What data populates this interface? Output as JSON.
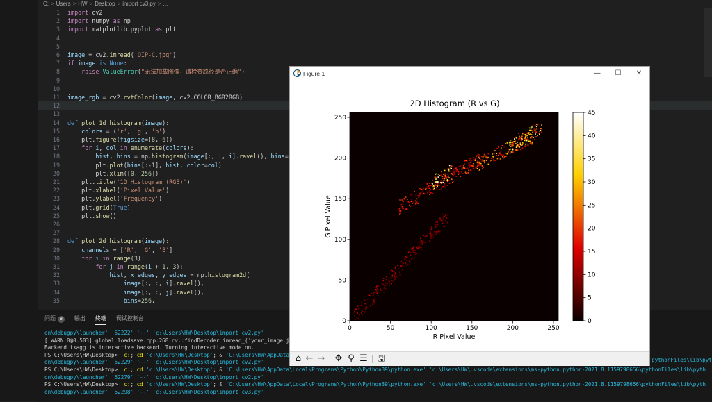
{
  "breadcrumb": [
    "C:",
    "Users",
    "HW",
    "Desktop",
    "import cv3.py",
    "..."
  ],
  "code_lines": [
    {
      "n": "1",
      "segs": [
        [
          "kw",
          "import "
        ],
        [
          "",
          "cv2"
        ]
      ]
    },
    {
      "n": "2",
      "segs": [
        [
          "kw",
          "import "
        ],
        [
          "",
          "numpy "
        ],
        [
          "kw",
          "as "
        ],
        [
          "",
          "np"
        ]
      ]
    },
    {
      "n": "3",
      "segs": [
        [
          "kw",
          "import "
        ],
        [
          "",
          "matplotlib.pyplot "
        ],
        [
          "kw",
          "as "
        ],
        [
          "",
          "plt"
        ]
      ]
    },
    {
      "n": "4",
      "segs": []
    },
    {
      "n": "5",
      "segs": []
    },
    {
      "n": "6",
      "segs": [
        [
          "vr",
          "image"
        ],
        [
          "",
          " = cv2."
        ],
        [
          "fn",
          "imread"
        ],
        [
          "",
          "("
        ],
        [
          "st",
          "'OIP-C.jpg'"
        ],
        [
          "",
          ")"
        ]
      ]
    },
    {
      "n": "7",
      "segs": [
        [
          "kw",
          "if "
        ],
        [
          "vr",
          "image "
        ],
        [
          "kb",
          "is None"
        ],
        [
          "",
          ":"
        ]
      ]
    },
    {
      "n": "8",
      "segs": [
        [
          "",
          "    "
        ],
        [
          "kw",
          "raise "
        ],
        [
          "cl",
          "ValueError"
        ],
        [
          "",
          "("
        ],
        [
          "st",
          "\"无法加载图像，请检查路径是否正确\""
        ],
        [
          "",
          ")"
        ]
      ]
    },
    {
      "n": "9",
      "segs": []
    },
    {
      "n": "10",
      "segs": []
    },
    {
      "n": "11",
      "segs": [
        [
          "vr",
          "image_rgb"
        ],
        [
          "",
          " = cv2."
        ],
        [
          "fn",
          "cvtColor"
        ],
        [
          "",
          "("
        ],
        [
          "vr",
          "image"
        ],
        [
          "",
          ", cv2.COLOR_BGR2RGB)"
        ]
      ]
    },
    {
      "n": "12",
      "segs": []
    },
    {
      "n": "13",
      "segs": []
    },
    {
      "n": "14",
      "segs": [
        [
          "kb",
          "def "
        ],
        [
          "fn",
          "plot_1d_histogram"
        ],
        [
          "",
          "("
        ],
        [
          "vr",
          "image"
        ],
        [
          "",
          "):"
        ]
      ]
    },
    {
      "n": "15",
      "segs": [
        [
          "",
          "    "
        ],
        [
          "vr",
          "colors"
        ],
        [
          "",
          " = ("
        ],
        [
          "st",
          "'r'"
        ],
        [
          "",
          ", "
        ],
        [
          "st",
          "'g'"
        ],
        [
          "",
          ", "
        ],
        [
          "st",
          "'b'"
        ],
        [
          "",
          ")"
        ]
      ]
    },
    {
      "n": "16",
      "segs": [
        [
          "",
          "    plt."
        ],
        [
          "fn",
          "figure"
        ],
        [
          "",
          "("
        ],
        [
          "vr",
          "figsize"
        ],
        [
          "",
          "=("
        ],
        [
          "nm",
          "8"
        ],
        [
          "",
          ", "
        ],
        [
          "nm",
          "6"
        ],
        [
          "",
          "))"
        ]
      ]
    },
    {
      "n": "17",
      "segs": [
        [
          "",
          "    "
        ],
        [
          "kw",
          "for "
        ],
        [
          "vr",
          "i"
        ],
        [
          "",
          ", "
        ],
        [
          "vr",
          "col "
        ],
        [
          "kw",
          "in "
        ],
        [
          "fn",
          "enumerate"
        ],
        [
          "",
          "("
        ],
        [
          "vr",
          "colors"
        ],
        [
          "",
          "):"
        ]
      ]
    },
    {
      "n": "18",
      "segs": [
        [
          "",
          "        "
        ],
        [
          "vr",
          "hist"
        ],
        [
          "",
          ", "
        ],
        [
          "vr",
          "bins"
        ],
        [
          "",
          " = np."
        ],
        [
          "fn",
          "histogram"
        ],
        [
          "",
          "("
        ],
        [
          "vr",
          "image"
        ],
        [
          "",
          "[:, :, "
        ],
        [
          "vr",
          "i"
        ],
        [
          "",
          "]."
        ],
        [
          "fn",
          "ravel"
        ],
        [
          "",
          "(), "
        ],
        [
          "vr",
          "bins"
        ],
        [
          "",
          "=2"
        ]
      ]
    },
    {
      "n": "19",
      "segs": [
        [
          "",
          "        plt."
        ],
        [
          "fn",
          "plot"
        ],
        [
          "",
          "("
        ],
        [
          "vr",
          "bins"
        ],
        [
          "",
          "[:-1], "
        ],
        [
          "vr",
          "hist"
        ],
        [
          "",
          ", "
        ],
        [
          "vr",
          "color"
        ],
        [
          "",
          "="
        ],
        [
          "vr",
          "col"
        ],
        [
          "",
          ")"
        ]
      ]
    },
    {
      "n": "20",
      "segs": [
        [
          "",
          "        plt."
        ],
        [
          "fn",
          "xlim"
        ],
        [
          "",
          "(["
        ],
        [
          "nm",
          "0"
        ],
        [
          "",
          ", "
        ],
        [
          "nm",
          "256"
        ],
        [
          "",
          "])"
        ]
      ]
    },
    {
      "n": "21",
      "segs": [
        [
          "",
          "    plt."
        ],
        [
          "fn",
          "title"
        ],
        [
          "",
          "("
        ],
        [
          "st",
          "'1D Histogram (RGB)'"
        ],
        [
          "",
          ")"
        ]
      ]
    },
    {
      "n": "22",
      "segs": [
        [
          "",
          "    plt."
        ],
        [
          "fn",
          "xlabel"
        ],
        [
          "",
          "("
        ],
        [
          "st",
          "'Pixel Value'"
        ],
        [
          "",
          ")"
        ]
      ]
    },
    {
      "n": "23",
      "segs": [
        [
          "",
          "    plt."
        ],
        [
          "fn",
          "ylabel"
        ],
        [
          "",
          "("
        ],
        [
          "st",
          "'Frequency'"
        ],
        [
          "",
          ")"
        ]
      ]
    },
    {
      "n": "24",
      "segs": [
        [
          "",
          "    plt."
        ],
        [
          "fn",
          "grid"
        ],
        [
          "",
          "("
        ],
        [
          "kb",
          "True"
        ],
        [
          "",
          ")"
        ]
      ]
    },
    {
      "n": "25",
      "segs": [
        [
          "",
          "    plt."
        ],
        [
          "fn",
          "show"
        ],
        [
          "",
          "()"
        ]
      ]
    },
    {
      "n": "26",
      "segs": []
    },
    {
      "n": "27",
      "segs": []
    },
    {
      "n": "28",
      "segs": [
        [
          "kb",
          "def "
        ],
        [
          "fn",
          "plot_2d_histogram"
        ],
        [
          "",
          "("
        ],
        [
          "vr",
          "image"
        ],
        [
          "",
          "):"
        ]
      ]
    },
    {
      "n": "29",
      "segs": [
        [
          "",
          "    "
        ],
        [
          "vr",
          "channels"
        ],
        [
          "",
          " = ["
        ],
        [
          "st",
          "'R'"
        ],
        [
          "",
          ", "
        ],
        [
          "st",
          "'G'"
        ],
        [
          "",
          ", "
        ],
        [
          "st",
          "'B'"
        ],
        [
          "",
          "]"
        ]
      ]
    },
    {
      "n": "30",
      "segs": [
        [
          "",
          "    "
        ],
        [
          "kw",
          "for "
        ],
        [
          "vr",
          "i "
        ],
        [
          "kw",
          "in "
        ],
        [
          "fn",
          "range"
        ],
        [
          "",
          "("
        ],
        [
          "nm",
          "3"
        ],
        [
          "",
          "):"
        ]
      ]
    },
    {
      "n": "31",
      "segs": [
        [
          "",
          "        "
        ],
        [
          "kw",
          "for "
        ],
        [
          "vr",
          "j "
        ],
        [
          "kw",
          "in "
        ],
        [
          "fn",
          "range"
        ],
        [
          "",
          "("
        ],
        [
          "vr",
          "i"
        ],
        [
          "",
          " + "
        ],
        [
          "nm",
          "1"
        ],
        [
          "",
          ", "
        ],
        [
          "nm",
          "3"
        ],
        [
          "",
          "):"
        ]
      ]
    },
    {
      "n": "32",
      "segs": [
        [
          "",
          "            "
        ],
        [
          "vr",
          "hist"
        ],
        [
          "",
          ", "
        ],
        [
          "vr",
          "x_edges"
        ],
        [
          "",
          ", "
        ],
        [
          "vr",
          "y_edges"
        ],
        [
          "",
          " = np."
        ],
        [
          "fn",
          "histogram2d"
        ],
        [
          "",
          "("
        ]
      ]
    },
    {
      "n": "33",
      "segs": [
        [
          "",
          "                "
        ],
        [
          "vr",
          "image"
        ],
        [
          "",
          "[:, :, "
        ],
        [
          "vr",
          "i"
        ],
        [
          "",
          "]."
        ],
        [
          "fn",
          "ravel"
        ],
        [
          "",
          "(),"
        ]
      ]
    },
    {
      "n": "34",
      "segs": [
        [
          "",
          "                "
        ],
        [
          "vr",
          "image"
        ],
        [
          "",
          "[:, :, "
        ],
        [
          "vr",
          "j"
        ],
        [
          "",
          "]."
        ],
        [
          "fn",
          "ravel"
        ],
        [
          "",
          "(),"
        ]
      ]
    },
    {
      "n": "35",
      "segs": [
        [
          "",
          "                "
        ],
        [
          "vr",
          "bins"
        ],
        [
          "",
          "="
        ],
        [
          "nm",
          "256"
        ],
        [
          "",
          ","
        ]
      ]
    }
  ],
  "panel": {
    "tabs": [
      {
        "label": "问题",
        "badge": "8"
      },
      {
        "label": "输出",
        "badge": ""
      },
      {
        "label": "终端",
        "badge": ""
      },
      {
        "label": "调试控制台",
        "badge": ""
      }
    ],
    "terminal_lines": [
      [
        [
          "t-cyan",
          "on\\debugpy\\launcher' '52222' '--' 'c:\\Users\\HW\\Desktop\\import cv2.py'"
        ]
      ],
      [
        [
          "",
          "[ WARN:0@0.503] global loadsave.cpp:268 cv::findDecoder imread_('your_image.j"
        ]
      ],
      [
        [
          "",
          "Backend tkagg is interactive backend. Turning interactive mode on."
        ]
      ],
      [
        [
          "",
          "PS C:\\Users\\HW\\Desktop>  "
        ],
        [
          "t-yel",
          "c:"
        ],
        [
          "",
          "; "
        ],
        [
          "t-yel",
          "cd "
        ],
        [
          "t-cyan",
          "'c:\\Users\\HW\\Desktop'"
        ],
        [
          "",
          "; & "
        ],
        [
          "t-cyan",
          "'C:\\Users\\HW\\AppData"
        ]
      ],
      [
        [
          "t-cyan",
          "on\\debugpy\\launcher' '52229' '--' 'c:\\Users\\HW\\Desktop\\import cv2.py'"
        ]
      ],
      [
        [
          "",
          "PS C:\\Users\\HW\\Desktop>  "
        ],
        [
          "t-yel",
          "c:"
        ],
        [
          "",
          "; "
        ],
        [
          "t-yel",
          "cd "
        ],
        [
          "t-cyan",
          "'c:\\Users\\HW\\Desktop'"
        ],
        [
          "",
          "; & "
        ],
        [
          "t-cyan",
          "'C:\\Users\\HW\\AppData\\Local\\Programs\\Python\\Python39\\python.exe' 'c:\\Users\\HW\\.vscode\\extensions\\ms-python.python-2021.8.1159798656\\pythonFiles\\lib\\pyth"
        ]
      ],
      [
        [
          "t-cyan",
          "on\\debugpy\\launcher' '52279' '--' 'c:\\Users\\HW\\Desktop\\import cv2.py'"
        ]
      ],
      [
        [
          "",
          "PS C:\\Users\\HW\\Desktop>  "
        ],
        [
          "t-yel",
          "c:"
        ],
        [
          "",
          "; "
        ],
        [
          "t-yel",
          "cd "
        ],
        [
          "t-cyan",
          "'c:\\Users\\HW\\Desktop'"
        ],
        [
          "",
          "; & "
        ],
        [
          "t-cyan",
          "'C:\\Users\\HW\\AppData\\Local\\Programs\\Python\\Python39\\python.exe' 'c:\\Users\\HW\\.vscode\\extensions\\ms-python.python-2021.8.1159798656\\pythonFiles\\lib\\pyth"
        ]
      ],
      [
        [
          "t-cyan",
          "on\\debugpy\\launcher' '52298' '--' 'c:\\Users\\HW\\Desktop\\import cv3.py'"
        ]
      ]
    ],
    "terminal_right_fragment_1": "pythonFiles\\lib\\pyth"
  },
  "figure": {
    "window_title": "Figure 1",
    "controls": {
      "minimize": "—",
      "maximize": "☐",
      "close": "✕"
    },
    "toolbar_icons": [
      "home-icon",
      "back-icon",
      "forward-icon",
      "pan-icon",
      "zoom-icon",
      "configure-icon",
      "save-icon"
    ],
    "toolbar_glyphs": {
      "home": "⌂",
      "back": "←",
      "forward": "→",
      "pan": "✥",
      "zoom": "⚲",
      "configure": "☰",
      "save": "🖫"
    }
  },
  "chart_data": {
    "type": "heatmap",
    "title": "2D Histogram (R vs G)",
    "xlabel": "R Pixel Value",
    "ylabel": "G Pixel Value",
    "xlim": [
      0,
      256
    ],
    "ylim": [
      0,
      256
    ],
    "xticks": [
      0,
      50,
      100,
      150,
      200,
      250
    ],
    "yticks": [
      0,
      50,
      100,
      150,
      200,
      250
    ],
    "colormap": "hot",
    "colorbar_range": [
      0,
      45
    ],
    "colorbar_ticks": [
      0,
      5,
      10,
      15,
      20,
      25,
      30,
      35,
      40,
      45
    ],
    "density_bands": [
      {
        "x": [
          5,
          120
        ],
        "y": [
          5,
          130
        ],
        "intensity": 0.25
      },
      {
        "x": [
          60,
          160
        ],
        "y": [
          140,
          200
        ],
        "intensity": 0.45
      },
      {
        "x": [
          100,
          125
        ],
        "y": [
          170,
          185
        ],
        "intensity": 0.9
      },
      {
        "x": [
          150,
          230
        ],
        "y": [
          190,
          230
        ],
        "intensity": 0.6
      },
      {
        "x": [
          195,
          235
        ],
        "y": [
          215,
          238
        ],
        "intensity": 0.8
      }
    ]
  }
}
